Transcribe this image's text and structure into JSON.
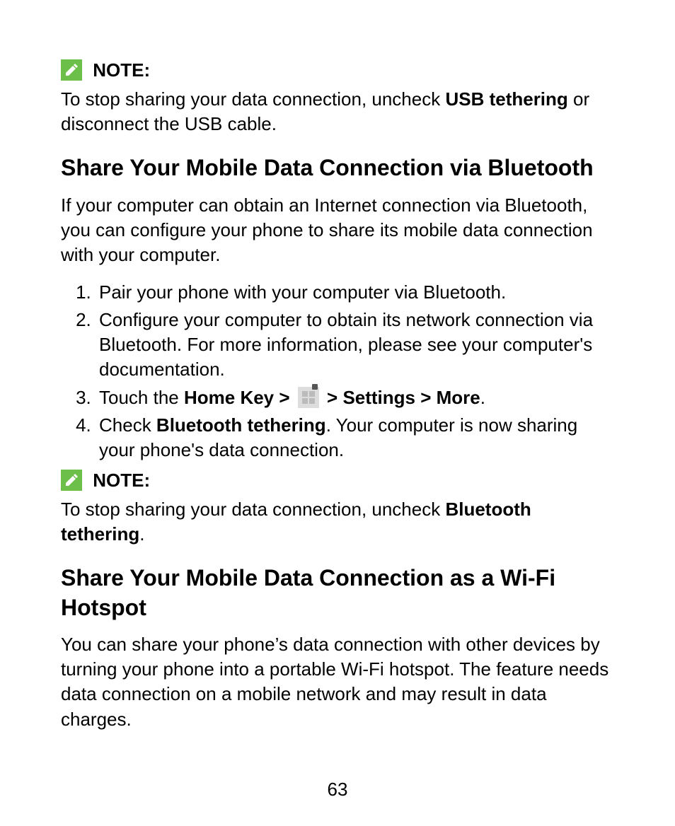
{
  "note1": {
    "label": "NOTE:",
    "text_a": "To stop sharing your data connection, uncheck ",
    "text_bold": "USB tethering",
    "text_b": " or disconnect the USB cable."
  },
  "section_bt": {
    "heading": "Share Your Mobile Data Connection via Bluetooth",
    "intro": "If your computer can obtain an Internet connection via Bluetooth, you can configure your phone to share its mobile data connection with your computer.",
    "steps": {
      "s1": "Pair your phone with your computer via Bluetooth.",
      "s2": "Configure your computer to obtain its network connection via Bluetooth. For more information, please see your computer's documentation.",
      "s3_a": "Touch the ",
      "s3_home": "Home Key >",
      "s3_b": "  ",
      "s3_settings": "> Settings > More",
      "s3_c": ".",
      "s4_a": "Check ",
      "s4_bold": "Bluetooth tethering",
      "s4_b": ". Your computer is now sharing your phone's data connection."
    }
  },
  "note2": {
    "label": "NOTE:",
    "text_a": "To stop sharing your data connection, uncheck ",
    "text_bold": "Bluetooth tethering",
    "text_b": "."
  },
  "section_wifi": {
    "heading": "Share Your Mobile Data Connection as a Wi-Fi Hotspot",
    "intro": "You can share your phone’s data connection with other devices by turning your phone into a portable Wi-Fi hotspot. The feature needs data connection on a mobile network and may result in data charges."
  },
  "page_number": "63"
}
